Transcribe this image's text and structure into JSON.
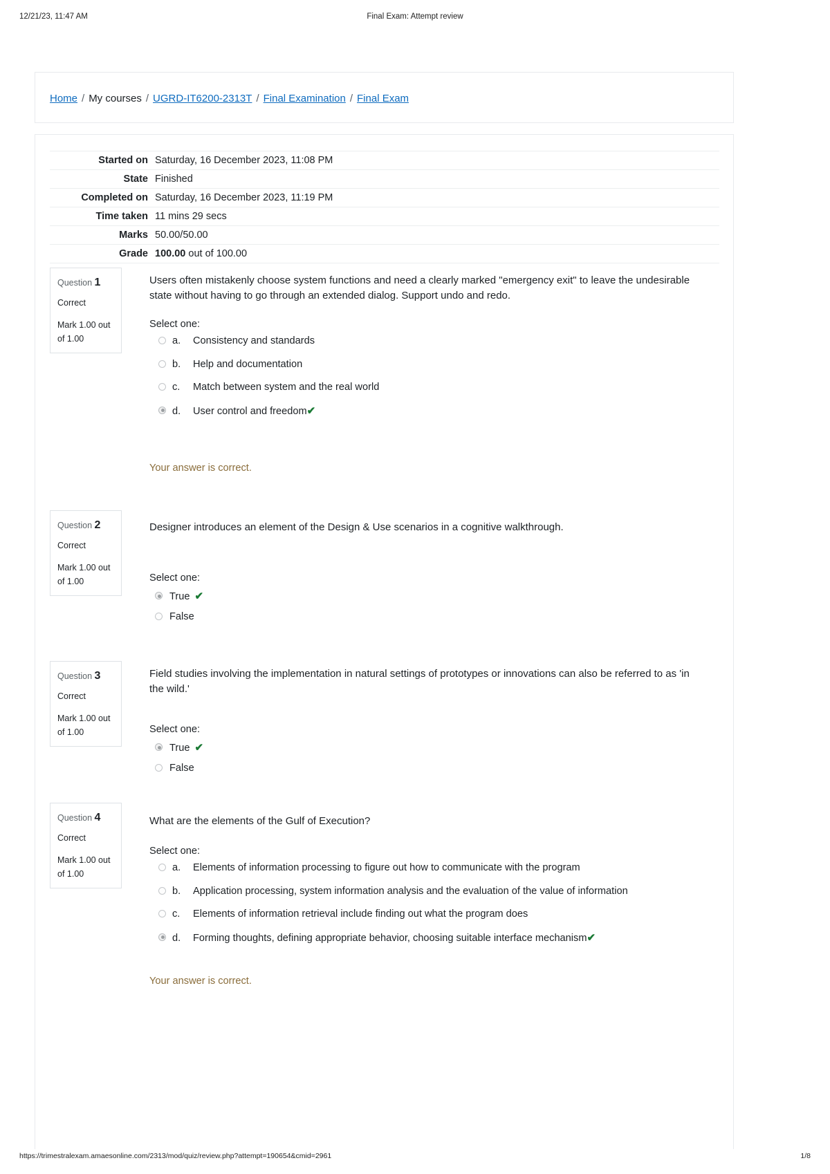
{
  "print": {
    "header_left": "12/21/23, 11:47 AM",
    "header_center": "Final Exam: Attempt review",
    "footer_url": "https://trimestralexam.amaesonline.com/2313/mod/quiz/review.php?attempt=190654&cmid=2961",
    "footer_page": "1/8"
  },
  "breadcrumb": {
    "items": [
      {
        "label": "Home",
        "link": true
      },
      {
        "label": "My courses",
        "link": false
      },
      {
        "label": "UGRD-IT6200-2313T",
        "link": true
      },
      {
        "label": "Final Examination",
        "link": true
      },
      {
        "label": "Final Exam",
        "link": true
      }
    ],
    "separator": "/"
  },
  "summary": {
    "rows": [
      {
        "label": "Started on",
        "value": "Saturday, 16 December 2023, 11:08 PM"
      },
      {
        "label": "State",
        "value": "Finished"
      },
      {
        "label": "Completed on",
        "value": "Saturday, 16 December 2023, 11:19 PM"
      },
      {
        "label": "Time taken",
        "value": "11 mins 29 secs"
      },
      {
        "label": "Marks",
        "value": "50.00/50.00"
      }
    ],
    "grade": {
      "label": "Grade",
      "value_bold": "100.00",
      "value_rest": " out of 100.00"
    }
  },
  "labels": {
    "question_word": "Question",
    "select_one": "Select one:",
    "correct_feedback": "Your answer is correct.",
    "tick": "✔"
  },
  "colors": {
    "link": "#0f6cbf",
    "feedback": "#8a6d3b",
    "tick_green": "#1a7a34",
    "border": "#e8eaed"
  },
  "questions": [
    {
      "number": "1",
      "state": "Correct",
      "mark": "Mark 1.00 out of 1.00",
      "text": "Users often mistakenly choose system functions and need a clearly marked \"emergency exit\" to leave the undesirable state without having to go through an extended dialog. Support undo and redo.",
      "type": "multichoice",
      "options": [
        {
          "letter": "a.",
          "text": "Consistency and standards",
          "selected": false,
          "correct": false
        },
        {
          "letter": "b.",
          "text": "Help and documentation",
          "selected": false,
          "correct": false
        },
        {
          "letter": "c.",
          "text": "Match between system and the real world",
          "selected": false,
          "correct": false
        },
        {
          "letter": "d.",
          "text": "User control and freedom",
          "selected": true,
          "correct": true
        }
      ],
      "feedback": "Your answer is correct."
    },
    {
      "number": "2",
      "state": "Correct",
      "mark": "Mark 1.00 out of 1.00",
      "text": "Designer introduces an element of the Design & Use scenarios in a cognitive walkthrough.",
      "type": "truefalse",
      "options": [
        {
          "letter": "",
          "text": "True",
          "selected": true,
          "correct": true
        },
        {
          "letter": "",
          "text": "False",
          "selected": false,
          "correct": false
        }
      ],
      "feedback": ""
    },
    {
      "number": "3",
      "state": "Correct",
      "mark": "Mark 1.00 out of 1.00",
      "text": "Field studies involving the implementation in natural settings of prototypes or innovations can also be referred to as 'in the wild.'",
      "type": "truefalse",
      "options": [
        {
          "letter": "",
          "text": "True",
          "selected": true,
          "correct": true
        },
        {
          "letter": "",
          "text": "False",
          "selected": false,
          "correct": false
        }
      ],
      "feedback": ""
    },
    {
      "number": "4",
      "state": "Correct",
      "mark": "Mark 1.00 out of 1.00",
      "text": "What are the elements of the Gulf of Execution?",
      "type": "multichoice",
      "options": [
        {
          "letter": "a.",
          "text": "Elements of information processing to figure out how to communicate with the program",
          "selected": false,
          "correct": false
        },
        {
          "letter": "b.",
          "text": "Application processing, system information analysis and the evaluation of the value of information",
          "selected": false,
          "correct": false
        },
        {
          "letter": "c.",
          "text": "Elements of information retrieval include finding out what the program does",
          "selected": false,
          "correct": false
        },
        {
          "letter": "d.",
          "text": "Forming thoughts, defining appropriate behavior, choosing suitable interface mechanism",
          "selected": true,
          "correct": true
        }
      ],
      "feedback": "Your answer is correct."
    }
  ]
}
